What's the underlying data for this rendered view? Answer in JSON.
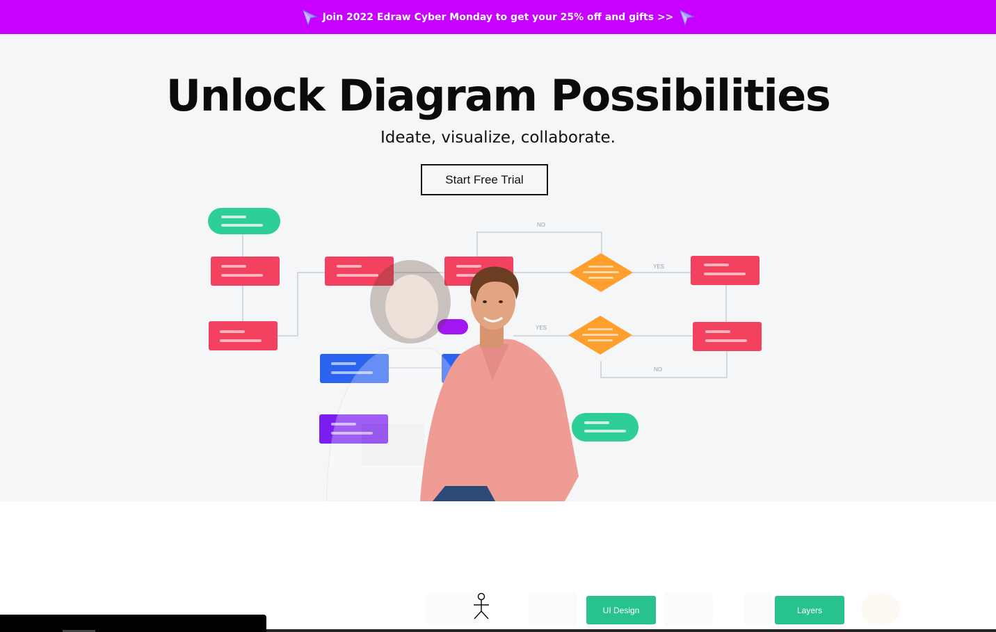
{
  "promo": {
    "text": "Join 2022 Edraw Cyber Monday to get your 25% off and gifts >>",
    "color": "#c700ff",
    "icon": "cursor-arrow-icon"
  },
  "hero": {
    "title": "Unlock Diagram Possibilities",
    "subtitle": "Ideate, visualize, collaborate.",
    "cta_label": "Start Free Trial",
    "background": "#f5f6f8"
  },
  "diagram": {
    "labels": {
      "no_top": "NO",
      "yes_right": "YES",
      "yes_left": "YES",
      "no_bottom": "NO"
    },
    "colors": {
      "green": "#2ecf96",
      "red": "#f3425f",
      "orange": "#ff9f2e",
      "blue": "#2b62f0",
      "purple": "#7a1ff0",
      "violet": "#a117f2"
    }
  },
  "lower": {
    "tags": {
      "ui_design": "UI Design",
      "layers": "Layers"
    },
    "tag_color": "#27c28f"
  }
}
